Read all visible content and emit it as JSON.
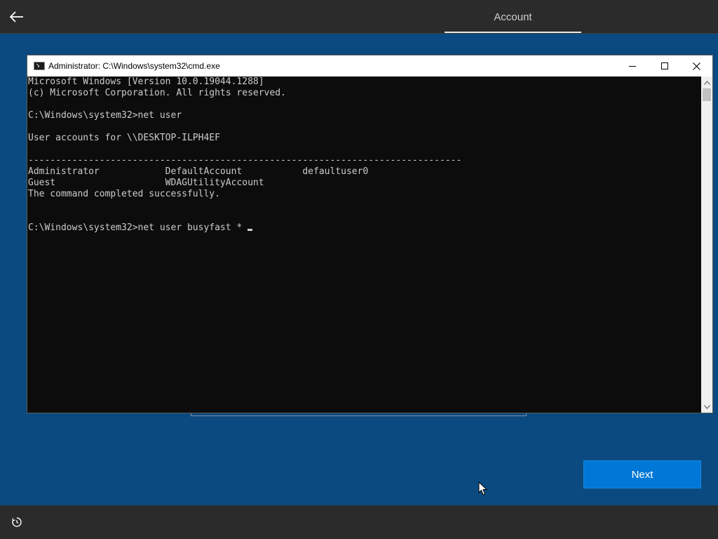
{
  "header": {
    "back_icon": "arrow-left-icon",
    "tab_label": "Account"
  },
  "cmd": {
    "title": "Administrator: C:\\Windows\\system32\\cmd.exe",
    "controls": [
      "minimize-icon",
      "maximize-icon",
      "close-icon"
    ],
    "lines": [
      "Microsoft Windows [Version 10.0.19044.1288]",
      "(c) Microsoft Corporation. All rights reserved.",
      "",
      "C:\\Windows\\system32>net user",
      "",
      "User accounts for \\\\DESKTOP-ILPH4EF",
      "",
      "-------------------------------------------------------------------------------",
      "Administrator            DefaultAccount           defaultuser0",
      "Guest                    WDAGUtilityAccount",
      "The command completed successfully.",
      "",
      ""
    ],
    "prompt_line": "C:\\Windows\\system32>net user busyfast * "
  },
  "footer": {
    "next_label": "Next",
    "ease_icon": "ease-of-access-icon"
  },
  "colors": {
    "background": "#0b4a80",
    "bar": "#2b2b2b",
    "accent": "#0078d7",
    "console_bg": "#0c0c0c",
    "console_text": "#cccccc"
  }
}
